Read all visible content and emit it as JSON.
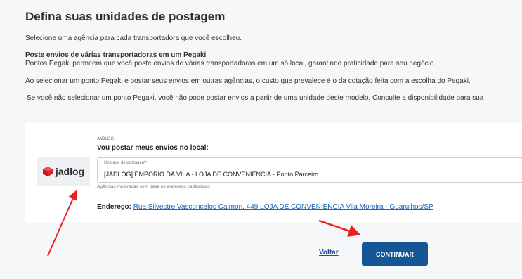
{
  "page": {
    "title": "Defina suas unidades de postagem",
    "intro": "Selecione uma agência para cada transportadora que você escolheu.",
    "multi_heading": "Poste envios de várias transportadoras em um Pegaki",
    "multi_text": "Pontos Pegaki permitem que você poste envios de várias transportadoras em um só local, garantindo praticidade para seu negócio.",
    "cost_text": "Ao selecionar um ponto Pegaki e postar seus envios em outras agências, o custo que prevalece é o da cotação feita com a escolha do Pegaki.",
    "warning_text": "Se você não selecionar um ponto Pegaki, você não pode postar envios a partir de uma unidade deste modelo. Consulte a disponibilidade para sua"
  },
  "carrier_card": {
    "logo_text": "jadlog",
    "carrier_label": "JADLOG",
    "question": "Vou postar meus envios no local:",
    "field_label": "Unidade de postagem*",
    "field_value": "[JADLOG] EMPORIO DA VILA - LOJA DE CONVENIENCIA - Ponto Parceiro",
    "helper": "Agências mostradas com base no endereço cadastrado",
    "address_label": "Endereço:",
    "address_link": "Rua Silvestre Vasconcelos Calmon, 449 LOJA DE CONVENIENCIA Vila Moreira - Guarulhos/SP"
  },
  "actions": {
    "back": "Voltar",
    "continue": "CONTINUAR"
  },
  "colors": {
    "accent": "#165596",
    "link": "#1e63b8",
    "annotation_arrow": "#e8231f",
    "brand_red": "#e0222c"
  }
}
